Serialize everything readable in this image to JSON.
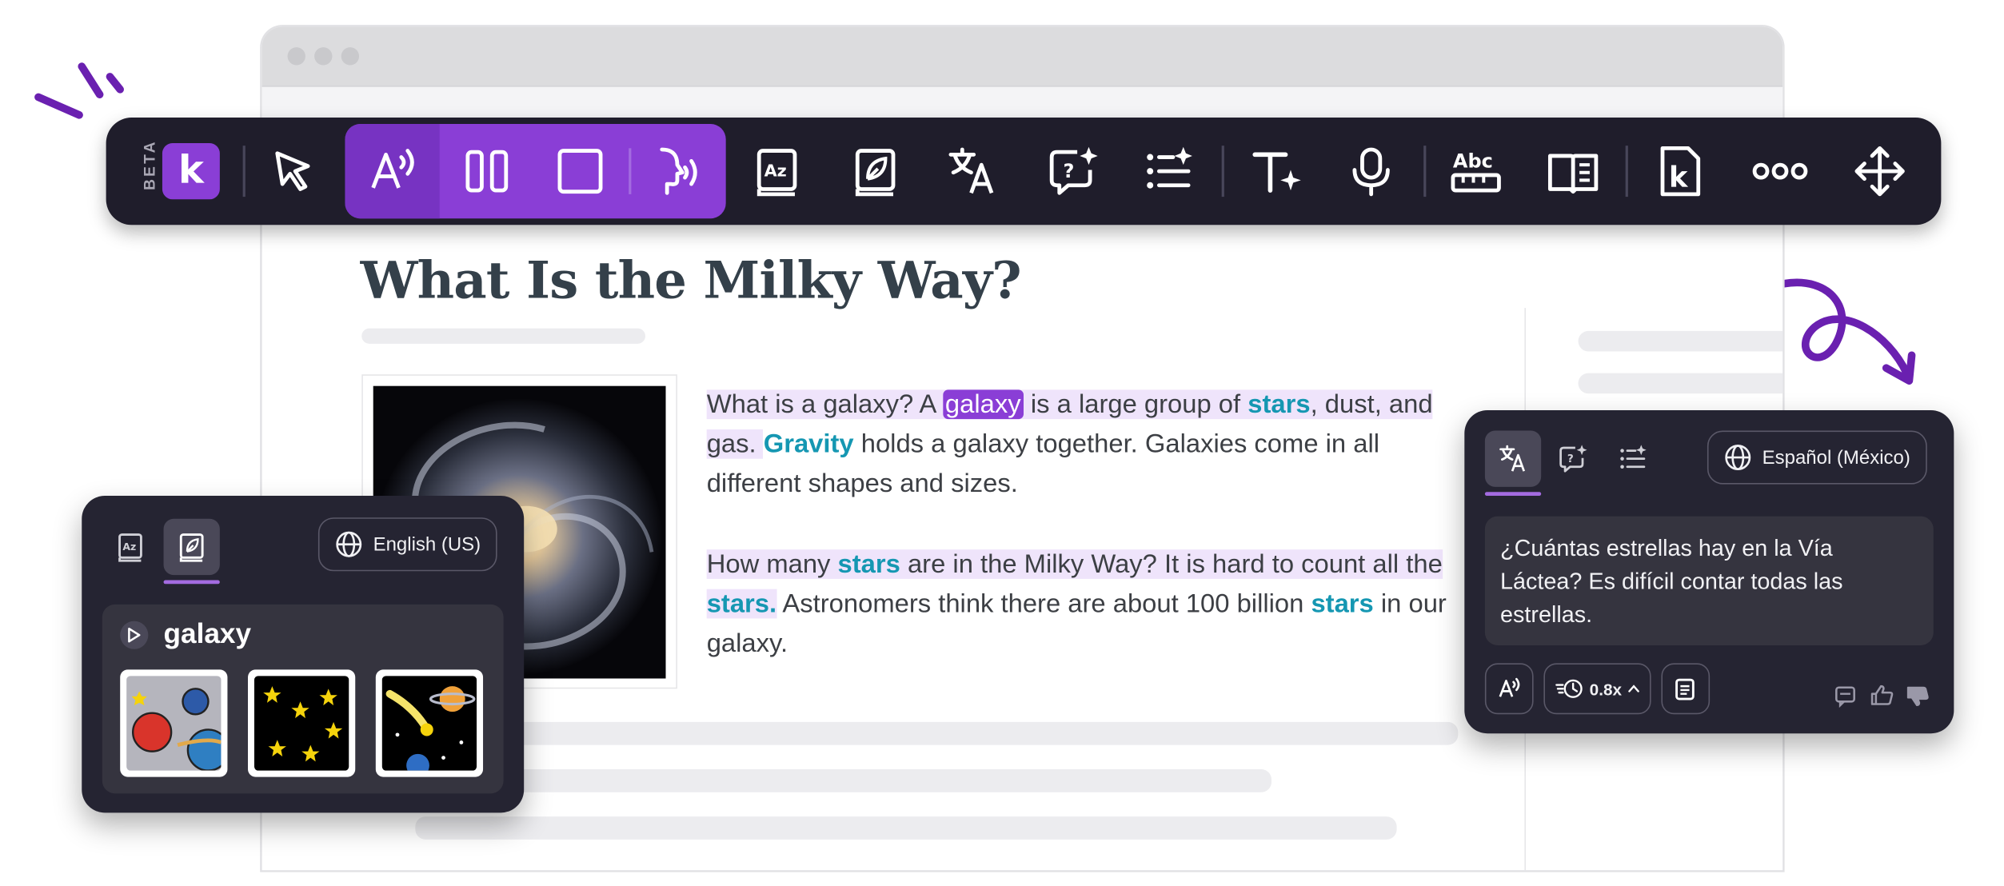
{
  "toolbar": {
    "beta_label": "BETA",
    "logo_letter": "k",
    "tools": [
      "pointer-select",
      "read-aloud",
      "column-view",
      "focus-box",
      "talk-back",
      "picture-dictionary",
      "dictionary",
      "translate",
      "question-ai",
      "summarize-list",
      "text-effects",
      "voice-input",
      "spelling",
      "reader-mode",
      "kami-logo",
      "more",
      "move"
    ]
  },
  "article": {
    "title": "What Is the Milky Way?",
    "p1": {
      "before_sel": "What is a galaxy? A ",
      "selected_word": "galaxy",
      "after_sel": " is a large group of ",
      "kw_stars": "stars",
      "mid1": ", dust, and gas. ",
      "kw_gravity": "Gravity",
      "rest": " holds a galaxy together. Galaxies come in all different shapes and sizes."
    },
    "p2": {
      "start": "How many ",
      "kw_stars": "stars",
      "mid": " are in the Milky Way? It is hard to count all the ",
      "kw_stars2": "stars.",
      "mid2": " Astronomers think there are about 100 billion ",
      "kw_stars3": "stars",
      "end": " in our galaxy."
    }
  },
  "dictionary_panel": {
    "language": "English (US)",
    "word": "galaxy",
    "images": [
      "planets-and-stars",
      "yellow-stars",
      "comet-and-saturn"
    ]
  },
  "translate_panel": {
    "language": "Español (México)",
    "translation": "¿Cuántas estrellas hay en la Vía Láctea? Es difícil contar todas las estrellas.",
    "speed": "0.8x"
  },
  "colors": {
    "accent": "#8a3ed6",
    "keyword": "#1597b2",
    "panel_bg": "#252432",
    "toolbar_bg": "#1f1d2b"
  }
}
